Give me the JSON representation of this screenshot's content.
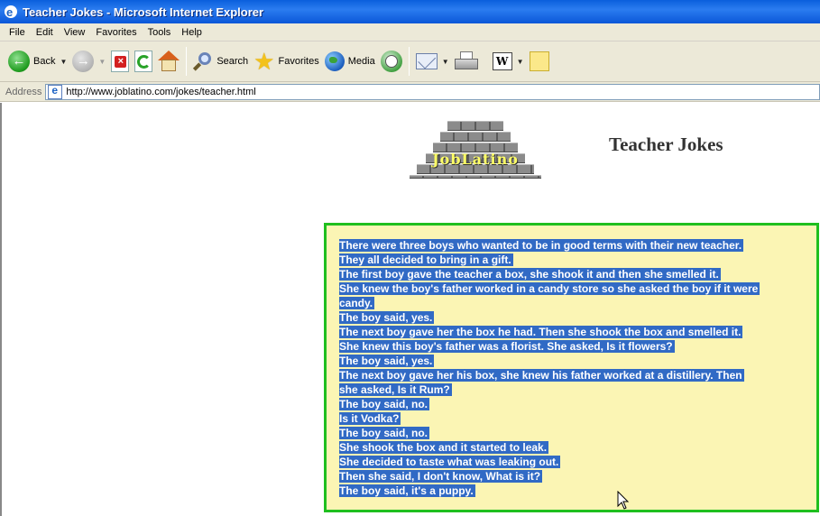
{
  "window": {
    "title": "Teacher Jokes - Microsoft Internet Explorer"
  },
  "menu": [
    "File",
    "Edit",
    "View",
    "Favorites",
    "Tools",
    "Help"
  ],
  "toolbar": {
    "back_label": "Back",
    "search_label": "Search",
    "favorites_label": "Favorites",
    "media_label": "Media"
  },
  "address": {
    "label": "Address",
    "url": "http://www.joblatino.com/jokes/teacher.html"
  },
  "page": {
    "logo_text": "JobLatino",
    "heading": "Teacher Jokes",
    "joke_lines": [
      "There were three boys who wanted to be in good terms with their new teacher.",
      "They all decided to bring in a gift.",
      "The first boy gave the teacher a box, she shook it and then she smelled it.",
      "She knew the boy's father worked in a candy store so she asked the boy if it were",
      "candy.",
      "The boy said, yes.",
      "The next boy gave her the box he had. Then she shook the box and smelled it.",
      "She knew this boy's father was a florist. She asked, Is it flowers?",
      "The boy said, yes.",
      "The next boy gave her his box, she knew his father worked at a distillery. Then",
      "she asked, Is it Rum?",
      "The boy said, no.",
      "Is it Vodka?",
      "The boy said, no.",
      "She shook the box and it started to leak.",
      "She decided to taste what was leaking out.",
      "Then she said, I don't know, What is it?",
      "The boy said, it's a puppy."
    ]
  },
  "colors": {
    "selection": "#316ac5",
    "joke_box_border": "#1fbf1f",
    "joke_box_bg": "#fbf5b4"
  }
}
